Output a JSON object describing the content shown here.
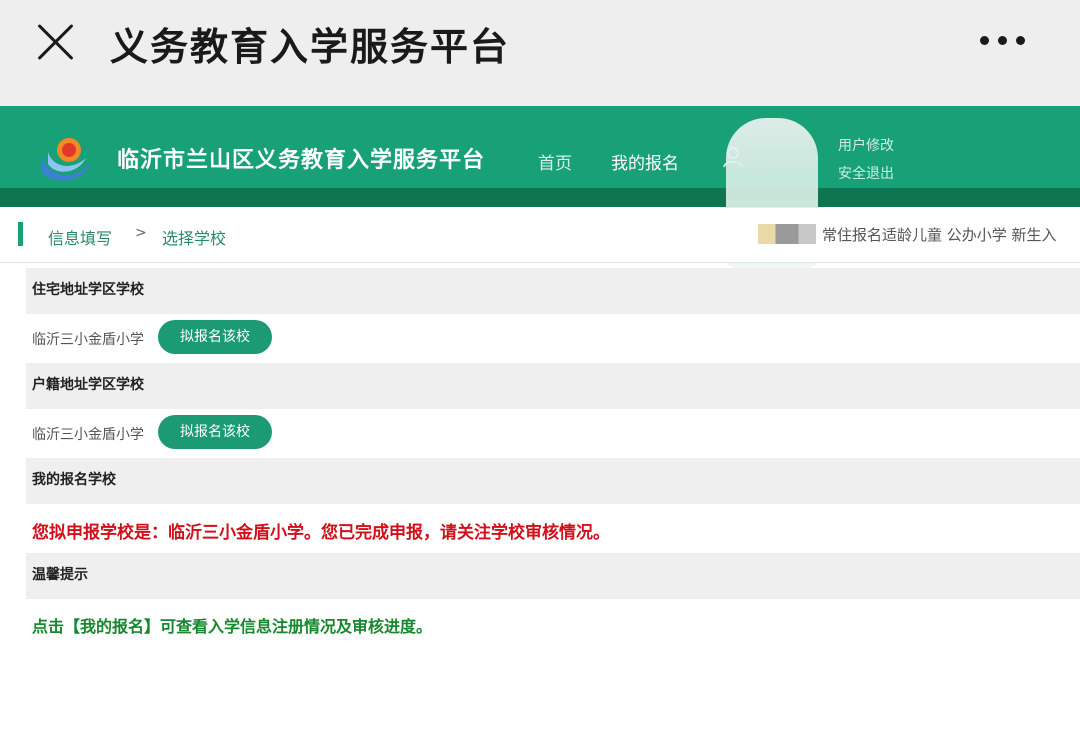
{
  "appbar": {
    "title": "义务教育入学服务平台",
    "close_icon": "close-icon",
    "more_icon": "more-icon"
  },
  "header": {
    "site_name": "临沂市兰山区义务教育入学服务平台",
    "nav": [
      {
        "label": "首页"
      },
      {
        "label": "我的报名"
      }
    ],
    "user_links": {
      "edit": "用户修改",
      "logout": "安全退出"
    },
    "brand_color": "#18a077"
  },
  "breadcrumb": {
    "step1": "信息填写",
    "separator": ">",
    "step2": "选择学校",
    "notice": "常住报名适龄儿童 公办小学 新生入"
  },
  "sections": {
    "residence": {
      "title": "住宅地址学区学校",
      "school": "临沂三小金盾小学",
      "button": "拟报名该校"
    },
    "household": {
      "title": "户籍地址学区学校",
      "school": "临沂三小金盾小学",
      "button": "拟报名该校"
    },
    "my_school": {
      "title": "我的报名学校",
      "message": "您拟申报学校是：临沂三小金盾小学。您已完成申报，请关注学校审核情况。"
    },
    "tips": {
      "title": "温馨提示",
      "message": "点击【我的报名】可查看入学信息注册情况及审核进度。"
    }
  },
  "colors": {
    "accent": "#18a077",
    "button": "#1b9a73",
    "alert_red": "#d0101a",
    "tip_green": "#17872e"
  }
}
